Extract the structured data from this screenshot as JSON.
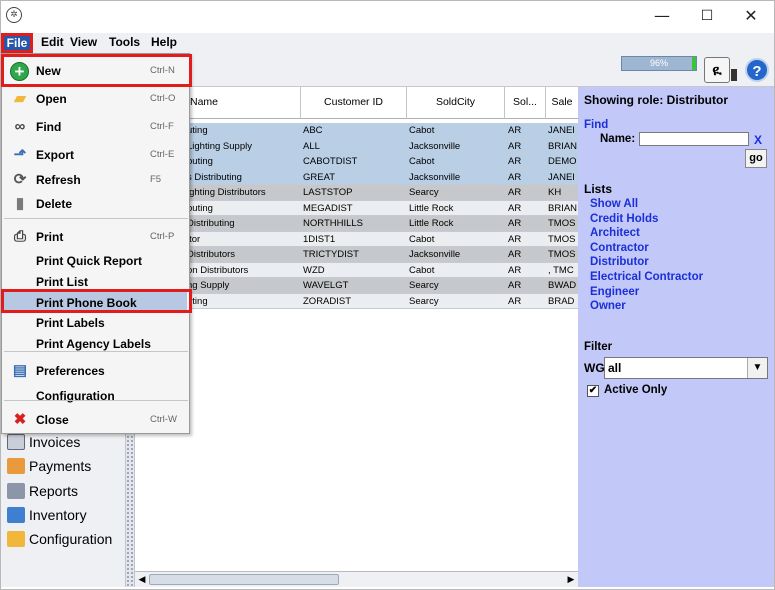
{
  "window": {
    "app_icon": "app-emblem-icon",
    "minimize": "—",
    "maximize": "☐",
    "close": "✕"
  },
  "menubar": {
    "file": "File",
    "edit": "Edit",
    "view": "View",
    "tools": "Tools",
    "help": "Help"
  },
  "toolbar": {
    "progress": "96%",
    "progress_value": 0.96,
    "help_glyph": "?"
  },
  "leftnav": {
    "items": [
      {
        "label": "Invoices",
        "icon": "invoice-icon"
      },
      {
        "label": "Payments",
        "icon": "payments-icon"
      },
      {
        "label": "Reports",
        "icon": "reports-icon"
      },
      {
        "label": "Inventory",
        "icon": "inventory-icon"
      },
      {
        "label": "Configuration",
        "icon": "folder-icon"
      }
    ]
  },
  "grid": {
    "columns": [
      "Name",
      "Customer ID",
      "SoldCity",
      "Sol...",
      "Sale"
    ],
    "rows": [
      {
        "name": "uting",
        "id": "ABC",
        "city": "Cabot",
        "state": "AR",
        "sale": "JANEI",
        "style": "blue"
      },
      {
        "name": "Lighting Supply",
        "id": "ALL",
        "city": "Jacksonville",
        "state": "AR",
        "sale": "BRIAN",
        "style": "blue"
      },
      {
        "name": "buting",
        "id": "CABOTDIST",
        "city": "Cabot",
        "state": "AR",
        "sale": "DEMO",
        "style": "blue"
      },
      {
        "name": "s Distributing",
        "id": "GREAT",
        "city": "Jacksonville",
        "state": "AR",
        "sale": "JANEI",
        "style": "blue"
      },
      {
        "name": "ighting Distributors",
        "id": "LASTSTOP",
        "city": "Searcy",
        "state": "AR",
        "sale": "KH",
        "style": "gray"
      },
      {
        "name": "buting",
        "id": "MEGADIST",
        "city": "Little Rock",
        "state": "AR",
        "sale": "BRIAN",
        "style": "white"
      },
      {
        "name": "Distributing",
        "id": "NORTHHILLS",
        "city": "Little Rock",
        "state": "AR",
        "sale": "TMOS",
        "style": "gray"
      },
      {
        "name": "itor",
        "id": "1DIST1",
        "city": "Cabot",
        "state": "AR",
        "sale": "TMOS",
        "style": "white"
      },
      {
        "name": "Distributors",
        "id": "TRICTYDIST",
        "city": "Jacksonville",
        "state": "AR",
        "sale": "TMOS",
        "style": "gray"
      },
      {
        "name": "on Distributors",
        "id": "WZD",
        "city": "Cabot",
        "state": "AR",
        "sale": ", TMC",
        "style": "white"
      },
      {
        "name": "ng Supply",
        "id": "WAVELGT",
        "city": "Searcy",
        "state": "AR",
        "sale": "BWAD",
        "style": "gray"
      },
      {
        "name": "uting",
        "id": "ZORADIST",
        "city": "Searcy",
        "state": "AR",
        "sale": "BRAD",
        "style": "white"
      }
    ]
  },
  "rightpanel": {
    "role": "Showing role: Distributor",
    "find": "Find",
    "name_label": "Name:",
    "name_value": "",
    "clear": "X",
    "go": "go",
    "lists_title": "Lists",
    "lists": [
      "Show All",
      "Credit Holds",
      "Architect",
      "Contractor",
      "Distributor",
      "Electrical Contractor",
      "Engineer",
      "Owner"
    ],
    "filter_title": "Filter",
    "wg_label": "WG:",
    "wg_value": "all",
    "active_only": "Active Only",
    "active_only_checked": "✔"
  },
  "file_menu": {
    "items": [
      {
        "label": "New",
        "shortcut": "Ctrl-N",
        "icon": "new-plus-icon",
        "glyph": "+"
      },
      {
        "label": "Open",
        "shortcut": "Ctrl-O",
        "icon": "folder-open-icon",
        "glyph": "▰"
      },
      {
        "label": "Find",
        "shortcut": "Ctrl-F",
        "icon": "binoculars-icon",
        "glyph": "∞"
      },
      {
        "label": "Export",
        "shortcut": "Ctrl-E",
        "icon": "export-icon",
        "glyph": "⬏"
      },
      {
        "label": "Refresh",
        "shortcut": "F5",
        "icon": "refresh-icon",
        "glyph": "⟳"
      },
      {
        "label": "Delete",
        "shortcut": "",
        "icon": "trash-icon",
        "glyph": "▮"
      },
      {
        "label": "Print",
        "shortcut": "Ctrl-P",
        "icon": "printer-icon",
        "glyph": "⎙"
      },
      {
        "label": "Print Quick Report",
        "shortcut": "",
        "icon": "",
        "glyph": ""
      },
      {
        "label": "Print List",
        "shortcut": "",
        "icon": "",
        "glyph": ""
      },
      {
        "label": "Print Phone Book",
        "shortcut": "",
        "icon": "",
        "glyph": ""
      },
      {
        "label": "Print Labels",
        "shortcut": "",
        "icon": "",
        "glyph": ""
      },
      {
        "label": "Print Agency Labels",
        "shortcut": "",
        "icon": "",
        "glyph": ""
      },
      {
        "label": "Preferences",
        "shortcut": "",
        "icon": "preferences-icon",
        "glyph": "▤"
      },
      {
        "label": "Configuration",
        "shortcut": "",
        "icon": "",
        "glyph": ""
      },
      {
        "label": "Close",
        "shortcut": "Ctrl-W",
        "icon": "close-x-icon",
        "glyph": "✖"
      }
    ]
  },
  "colors": {
    "highlight": "#e01c1c",
    "panel_bg": "#c2c8f7",
    "link_blue": "#1c2fd8"
  }
}
